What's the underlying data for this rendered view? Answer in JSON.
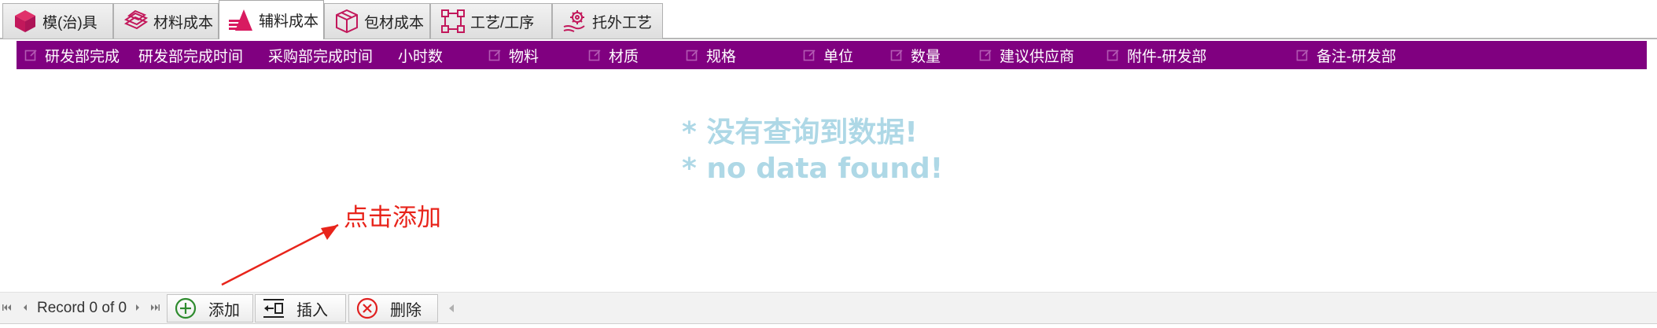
{
  "tabs": [
    {
      "label": "模(治)具",
      "icon": "cube-icon"
    },
    {
      "label": "材料成本",
      "icon": "stacked-sheets-icon"
    },
    {
      "label": "辅料成本",
      "icon": "cone-lines-icon",
      "active": true
    },
    {
      "label": "包材成本",
      "icon": "package-box-icon"
    },
    {
      "label": "工艺/工序",
      "icon": "process-flow-icon"
    },
    {
      "label": "托外工艺",
      "icon": "outsourcing-gear-icon"
    }
  ],
  "grid": {
    "header_color": "#800080",
    "columns": [
      {
        "label": "研发部完成",
        "editable_icon": true
      },
      {
        "label": "研发部完成时间",
        "editable_icon": false
      },
      {
        "label": "采购部完成时间",
        "editable_icon": false
      },
      {
        "label": "小时数",
        "editable_icon": false
      },
      {
        "label": "物料",
        "editable_icon": true
      },
      {
        "label": "材质",
        "editable_icon": true
      },
      {
        "label": "规格",
        "editable_icon": true
      },
      {
        "label": "单位",
        "editable_icon": true
      },
      {
        "label": "数量",
        "editable_icon": true
      },
      {
        "label": "建议供应商",
        "editable_icon": true
      },
      {
        "label": "附件-研发部",
        "editable_icon": true
      },
      {
        "label": "备注-研发部",
        "editable_icon": true
      }
    ],
    "rows": [],
    "empty_message": {
      "line1": "* 没有查询到数据!",
      "line2": "* no data found!",
      "color": "#aed8e6"
    }
  },
  "annotation": {
    "text": "点击添加",
    "color": "#e8241b"
  },
  "navigator": {
    "record_text": "Record 0 of 0",
    "buttons": {
      "add": "添加",
      "insert": "插入",
      "delete": "删除"
    }
  }
}
